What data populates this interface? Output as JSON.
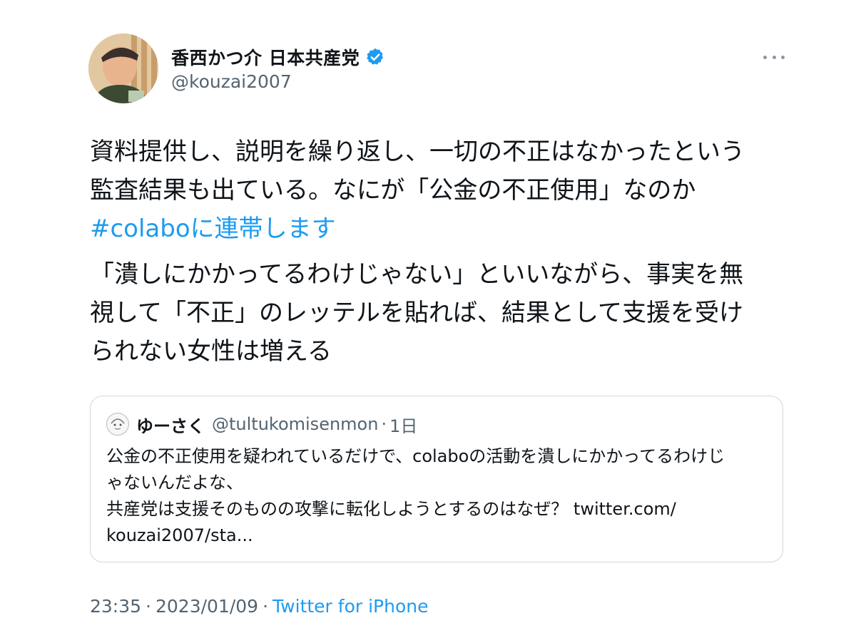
{
  "author": {
    "name": "香西かつ介 日本共産党",
    "handle": "@kouzai2007",
    "verified": true
  },
  "tweet": {
    "line1": "資料提供し、説明を繰り返し、一切の不正はなかったという",
    "line2": "監査結果も出ている。なにが「公金の不正使用」なのか",
    "hashtag": "#colaboに連帯します",
    "para2_line1": "「潰しにかかってるわけじゃない」といいながら、事実を無",
    "para2_line2": "視して「不正」のレッテルを貼れば、結果として支援を受け",
    "para2_line3": "られない女性は増える"
  },
  "quote": {
    "name": "ゆーさく",
    "handle": "@tultukomisenmon",
    "separator": "·",
    "time": "1日",
    "line1": "公金の不正使用を疑われているだけで、colaboの活動を潰しにかかってるわけじ",
    "line2": "ゃないんだよな、",
    "line3": "共産党は支援そのものの攻撃に転化しようとするのはなぜ？ twitter.com/",
    "line4": "kouzai2007/sta..."
  },
  "footer": {
    "time": "23:35",
    "date": "2023/01/09",
    "separator": "·",
    "source": "Twitter for iPhone"
  },
  "icons": {
    "verified": "verified-badge-icon",
    "more": "more-options-icon"
  },
  "colors": {
    "accent": "#1d9bf0",
    "secondary_text": "#536471",
    "border": "#cfd9de"
  }
}
